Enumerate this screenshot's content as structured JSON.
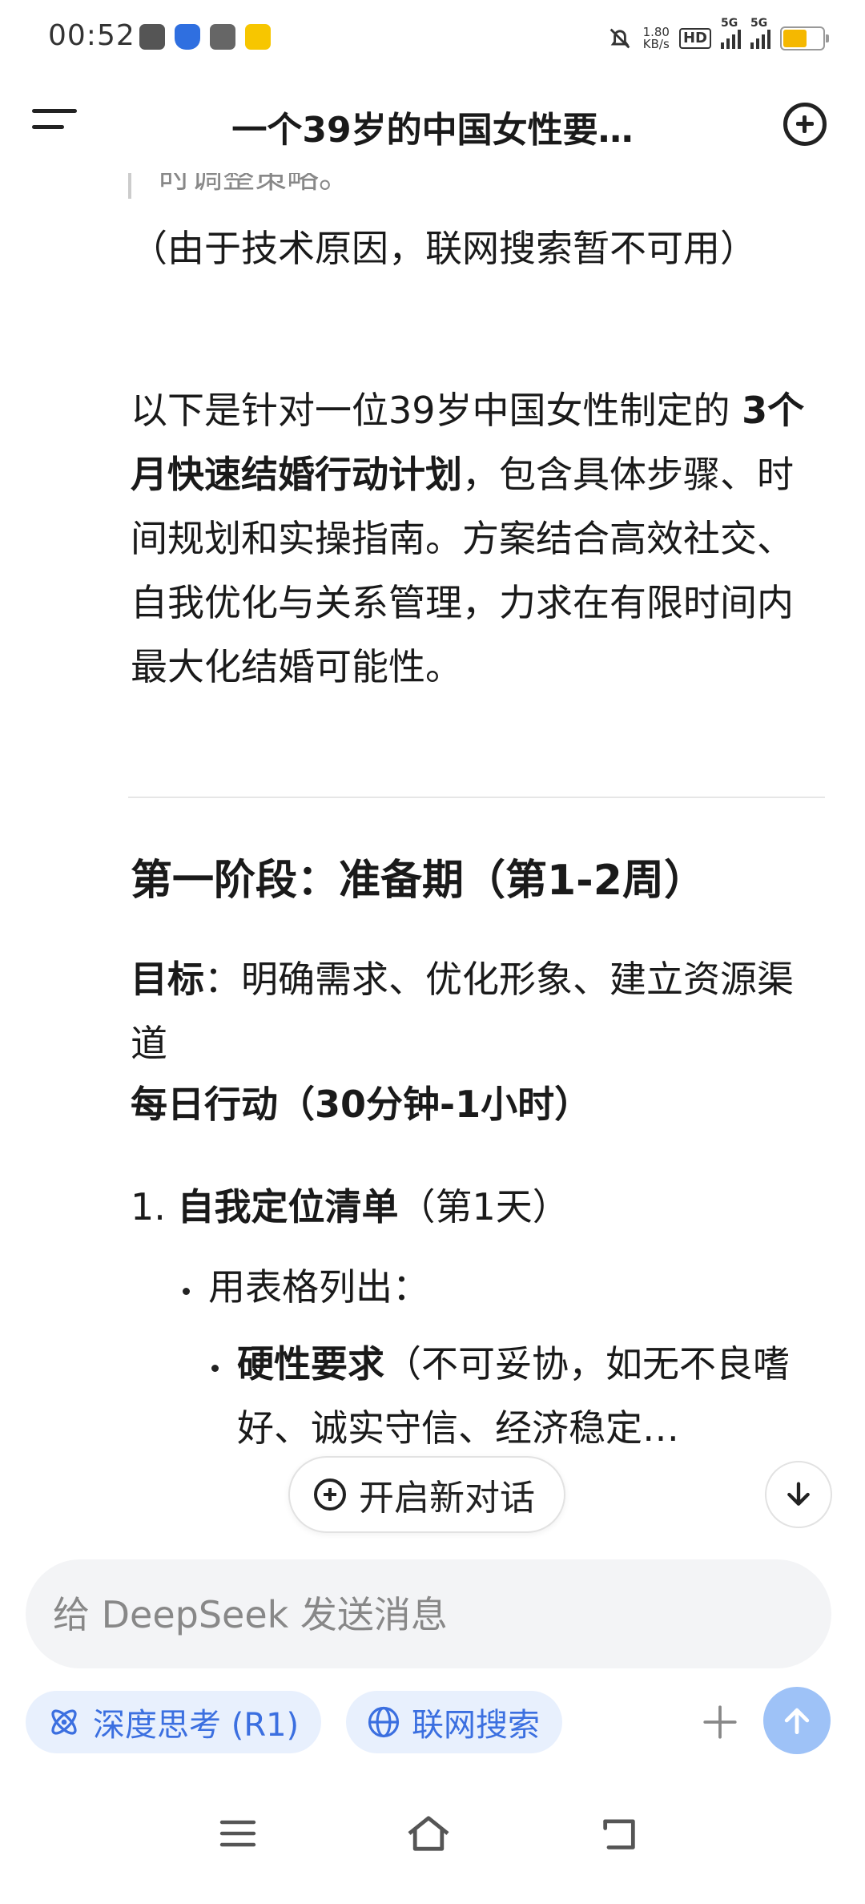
{
  "status_bar": {
    "time": "00:52",
    "net_speed_value": "1.80",
    "net_speed_unit": "KB/s",
    "hd_label": "HD",
    "sim1_label": "5G",
    "sim2_label": "5G",
    "battery_level": 0.6,
    "battery_color": "#f5b800"
  },
  "header": {
    "title": "一个39岁的中国女性要…",
    "menu_icon": "menu-icon",
    "new_chat_icon": "new-chat-icon"
  },
  "message": {
    "quote_fragment": "时调整策略。",
    "network_note": "（由于技术原因，联网搜索暂不可用）",
    "intro_before": "以下是针对一位39岁中国女性制定的 ",
    "intro_bold": "3个月快速结婚行动计划",
    "intro_after": "，包含具体步骤、时间规划和实操指南。方案结合高效社交、自我优化与关系管理，力求在有限时间内最大化结婚可能性。",
    "phase1_heading": "第一阶段：准备期（第1-2周）",
    "goal_label": "目标",
    "goal_text": "：明确需求、优化形象、建立资源渠道",
    "daily_action": "每日行动（30分钟-1小时）",
    "item1_number": "1.",
    "item1_bold": "自我定位清单",
    "item1_rest": "（第1天）",
    "sub1": "用表格列出：",
    "sub2_bold": "硬性要求",
    "sub2_rest": "（不可妥协，如无不良嗜好、诚实守信、经济稳定…"
  },
  "floating": {
    "new_chat_label": "开启新对话"
  },
  "composer": {
    "placeholder": "给 DeepSeek 发送消息",
    "deep_think_label": "深度思考 (R1)",
    "web_search_label": "联网搜索"
  },
  "colors": {
    "accent": "#3b6fe0",
    "chip_bg": "#e8f0fd",
    "send_bg": "#9ec2f7"
  }
}
